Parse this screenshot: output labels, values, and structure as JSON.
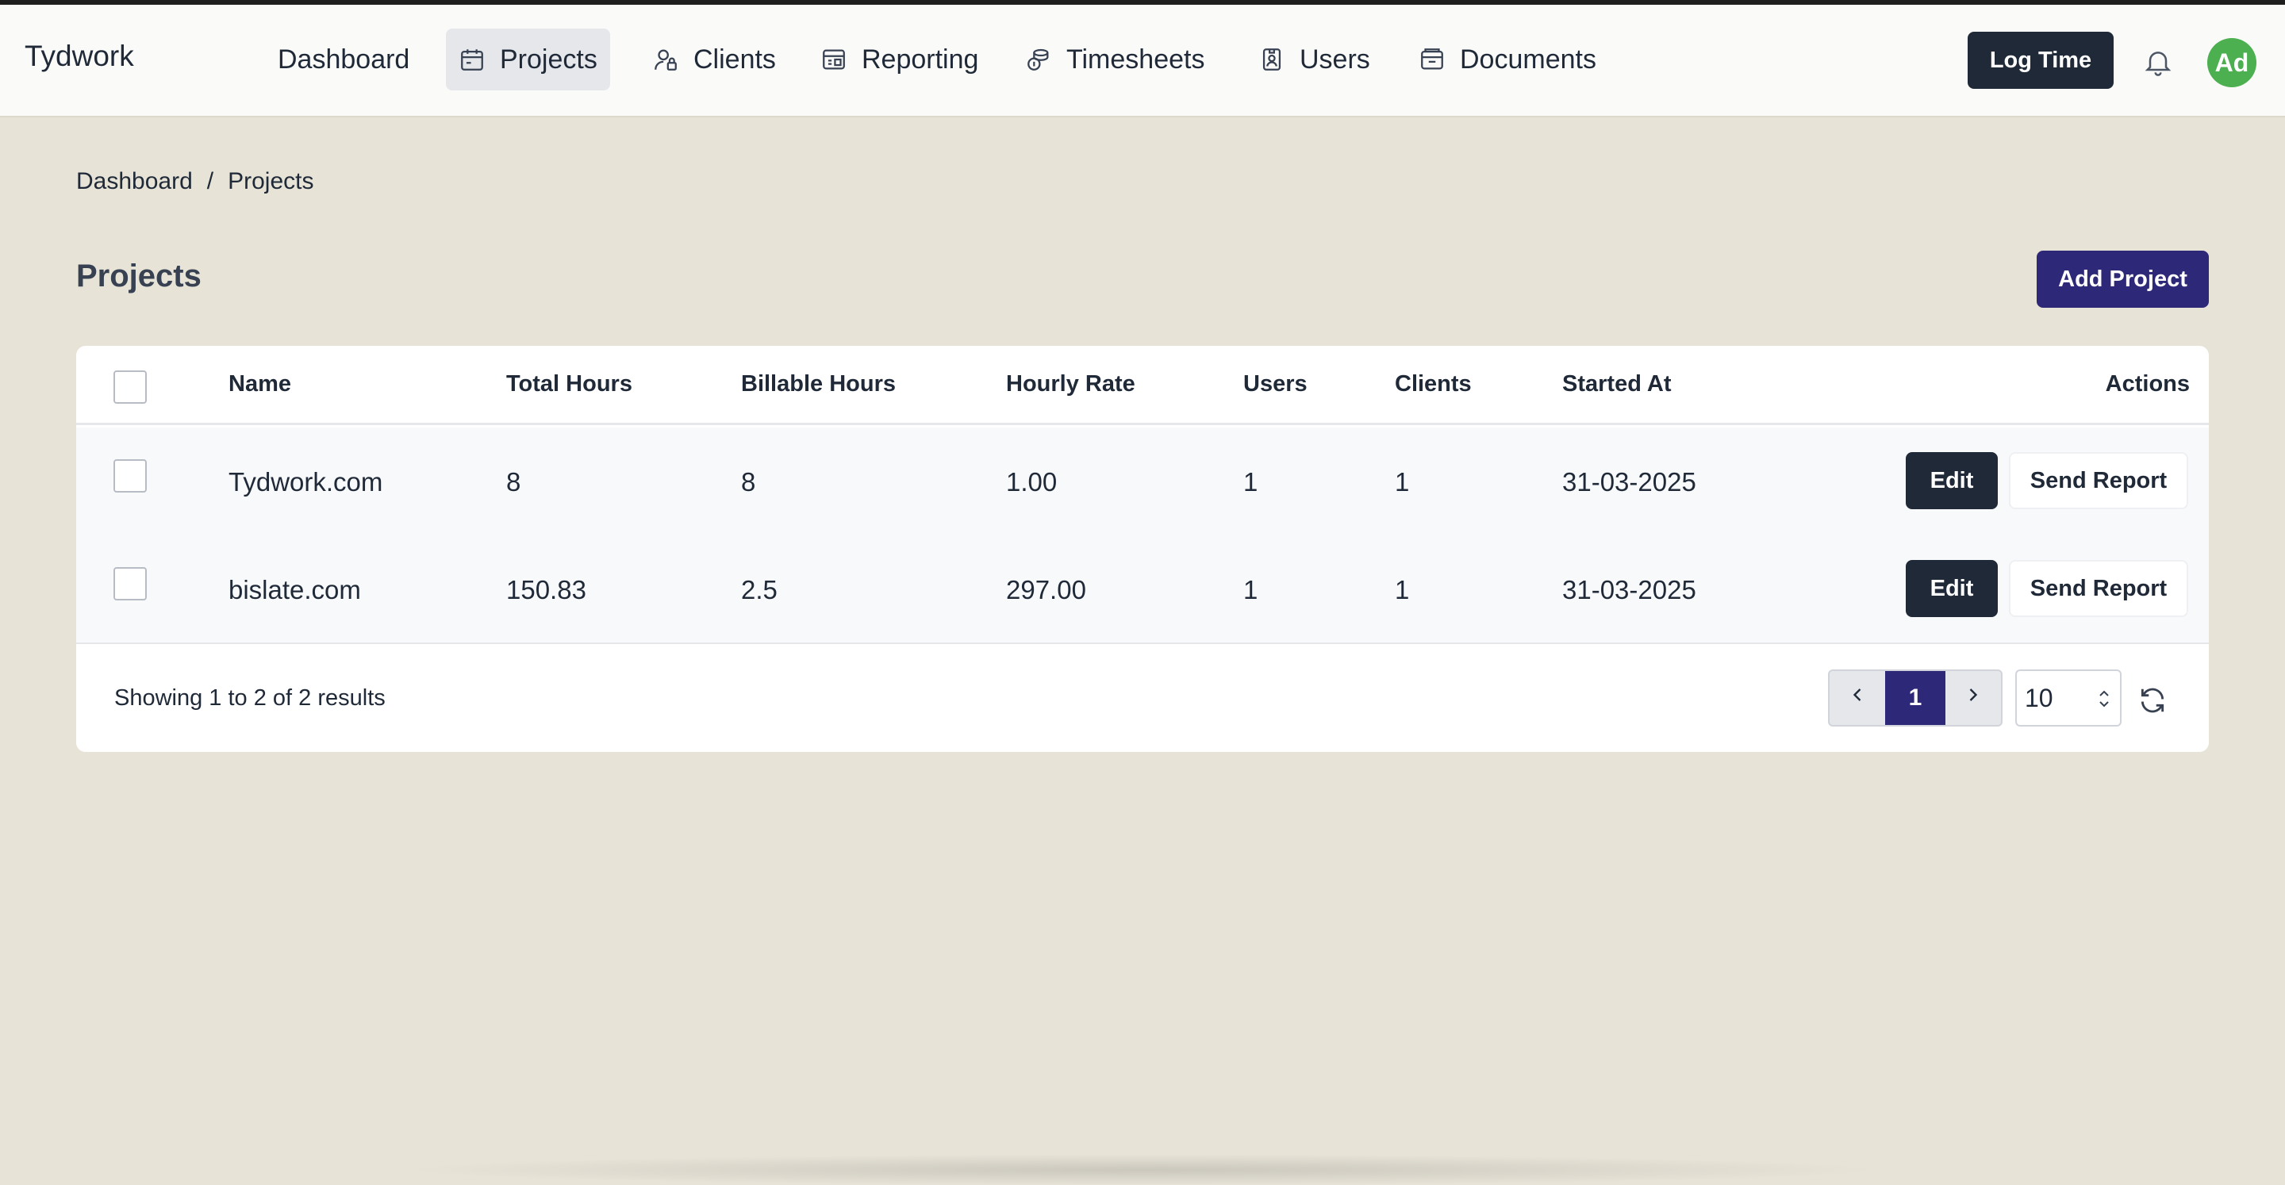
{
  "app": {
    "brand": "Tydwork"
  },
  "nav": {
    "items": [
      {
        "label": "Dashboard",
        "icon": "none"
      },
      {
        "label": "Projects",
        "icon": "calendar-icon"
      },
      {
        "label": "Clients",
        "icon": "user-lock-icon"
      },
      {
        "label": "Reporting",
        "icon": "report-icon"
      },
      {
        "label": "Timesheets",
        "icon": "coins-icon"
      },
      {
        "label": "Users",
        "icon": "id-badge-icon"
      },
      {
        "label": "Documents",
        "icon": "folder-icon"
      }
    ],
    "log_time": "Log Time",
    "avatar": "Ad"
  },
  "breadcrumb": {
    "items": [
      "Dashboard",
      "Projects"
    ],
    "separator": "/"
  },
  "page": {
    "title": "Projects",
    "add_button": "Add Project"
  },
  "table": {
    "columns": [
      "Name",
      "Total Hours",
      "Billable Hours",
      "Hourly Rate",
      "Users",
      "Clients",
      "Started At",
      "Actions"
    ],
    "rows": [
      {
        "name": "Tydwork.com",
        "total_hours": "8",
        "billable_hours": "8",
        "hourly_rate": "1.00",
        "users": "1",
        "clients": "1",
        "started_at": "31-03-2025"
      },
      {
        "name": "bislate.com",
        "total_hours": "150.83",
        "billable_hours": "2.5",
        "hourly_rate": "297.00",
        "users": "1",
        "clients": "1",
        "started_at": "31-03-2025"
      }
    ],
    "edit_label": "Edit",
    "send_report_label": "Send Report"
  },
  "footer": {
    "results": "Showing 1 to 2 of 2 results",
    "current_page": "1",
    "per_page": "10"
  },
  "colors": {
    "accent": "#2e2878",
    "dark": "#1f2937",
    "background": "#e7e3d7",
    "avatar": "#4caf50"
  }
}
